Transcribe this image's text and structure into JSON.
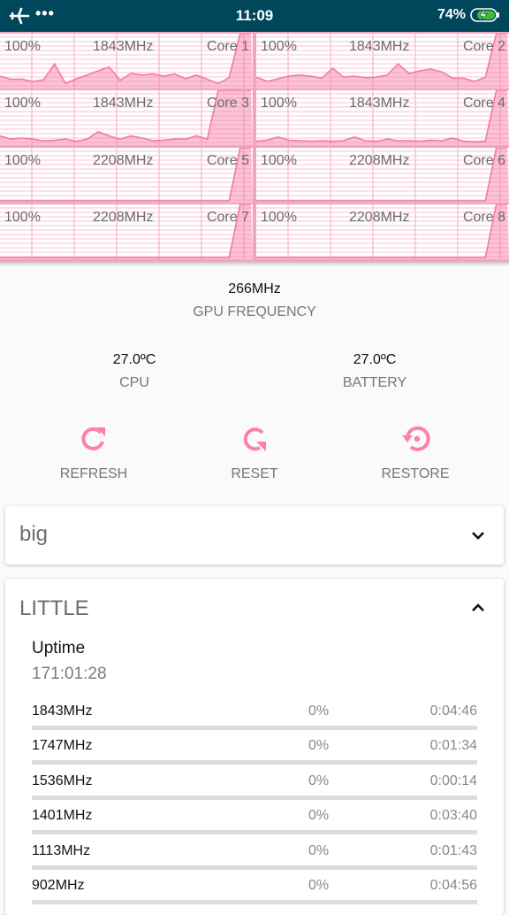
{
  "status_bar": {
    "left_icons": [
      "airplane-mode-icon",
      "more-notifications-icon"
    ],
    "time": "11:09",
    "battery_percent": "74%",
    "battery_icon": "battery-charging-icon"
  },
  "colors": {
    "accent": "#ff80a6",
    "status_bar_bg": "#00475c",
    "graph_border": "#f27aa0",
    "graph_fill": "#f9b2c8",
    "battery_fill": "#3fbf2f"
  },
  "cores": [
    {
      "usage": "100%",
      "freq": "1843MHz",
      "name": "Core 1",
      "history": [
        0.2,
        0.14,
        0.14,
        0.1,
        0.13,
        0.43,
        0.06,
        0.15,
        0.22,
        0.3,
        0.37,
        0.12,
        0.25,
        0.22,
        0.24,
        0.2,
        0.24,
        0.15,
        0.22,
        0.14,
        0.06,
        0.17,
        1.0,
        1.0
      ]
    },
    {
      "usage": "100%",
      "freq": "1843MHz",
      "name": "Core 2",
      "history": [
        0.18,
        0.1,
        0.15,
        0.2,
        0.22,
        0.2,
        0.16,
        0.35,
        0.18,
        0.2,
        0.17,
        0.18,
        0.22,
        0.43,
        0.25,
        0.3,
        0.33,
        0.28,
        0.16,
        0.16,
        0.1,
        0.18,
        1.0,
        1.0
      ]
    },
    {
      "usage": "100%",
      "freq": "1843MHz",
      "name": "Core 3",
      "history": [
        0.14,
        0.08,
        0.1,
        0.08,
        0.05,
        0.06,
        0.08,
        0.04,
        0.08,
        0.22,
        0.14,
        0.08,
        0.14,
        0.1,
        0.05,
        0.06,
        0.08,
        0.08,
        0.14,
        0.08,
        1.0,
        1.0,
        1.0,
        1.0
      ]
    },
    {
      "usage": "100%",
      "freq": "1843MHz",
      "name": "Core 4",
      "history": [
        0.04,
        0.06,
        0.12,
        0.06,
        0.05,
        0.04,
        0.05,
        0.04,
        0.05,
        0.12,
        0.05,
        0.04,
        0.08,
        0.05,
        0.05,
        0.04,
        0.06,
        0.05,
        0.1,
        0.04,
        0.03,
        0.04,
        1.0,
        1.0
      ]
    },
    {
      "usage": "100%",
      "freq": "2208MHz",
      "name": "Core 5",
      "history": [
        0,
        0,
        0,
        0,
        0,
        0,
        0,
        0,
        0,
        0,
        0,
        0,
        0,
        0,
        0,
        0,
        0,
        0,
        0,
        0,
        0,
        0,
        1.0,
        1.0
      ]
    },
    {
      "usage": "100%",
      "freq": "2208MHz",
      "name": "Core 6",
      "history": [
        0,
        0,
        0,
        0,
        0,
        0,
        0,
        0,
        0,
        0,
        0,
        0,
        0,
        0,
        0,
        0,
        0,
        0,
        0,
        0,
        0,
        0,
        1.0,
        1.0
      ]
    },
    {
      "usage": "100%",
      "freq": "2208MHz",
      "name": "Core 7",
      "history": [
        0,
        0,
        0,
        0,
        0,
        0,
        0,
        0,
        0,
        0,
        0,
        0,
        0,
        0,
        0,
        0,
        0,
        0,
        0,
        0,
        0,
        0,
        1.0,
        1.0
      ]
    },
    {
      "usage": "100%",
      "freq": "2208MHz",
      "name": "Core 8",
      "history": [
        0,
        0,
        0,
        0,
        0,
        0,
        0,
        0,
        0,
        0,
        0,
        0,
        0,
        0,
        0,
        0,
        0,
        0,
        0,
        0,
        0,
        0,
        1.0,
        1.0
      ]
    }
  ],
  "gpu": {
    "value": "266MHz",
    "label": "GPU FREQUENCY"
  },
  "temps": {
    "cpu": {
      "value": "27.0ºC",
      "label": "CPU"
    },
    "battery": {
      "value": "27.0ºC",
      "label": "BATTERY"
    }
  },
  "actions": [
    {
      "label": "REFRESH",
      "icon": "refresh-icon"
    },
    {
      "label": "RESET",
      "icon": "reset-icon"
    },
    {
      "label": "RESTORE",
      "icon": "restore-icon"
    }
  ],
  "clusters": {
    "big": {
      "title": "big",
      "expanded": false,
      "toggle_icon": "chevron-down-icon"
    },
    "little": {
      "title": "LITTLE",
      "expanded": true,
      "toggle_icon": "chevron-up-icon",
      "uptime_label": "Uptime",
      "uptime_value": "171:01:28",
      "states": [
        {
          "freq": "1843MHz",
          "percent": "0%",
          "time": "0:04:46",
          "fraction": 0
        },
        {
          "freq": "1747MHz",
          "percent": "0%",
          "time": "0:01:34",
          "fraction": 0
        },
        {
          "freq": "1536MHz",
          "percent": "0%",
          "time": "0:00:14",
          "fraction": 0
        },
        {
          "freq": "1401MHz",
          "percent": "0%",
          "time": "0:03:40",
          "fraction": 0
        },
        {
          "freq": "1113MHz",
          "percent": "0%",
          "time": "0:01:43",
          "fraction": 0
        },
        {
          "freq": "902MHz",
          "percent": "0%",
          "time": "0:04:56",
          "fraction": 0
        }
      ]
    }
  }
}
